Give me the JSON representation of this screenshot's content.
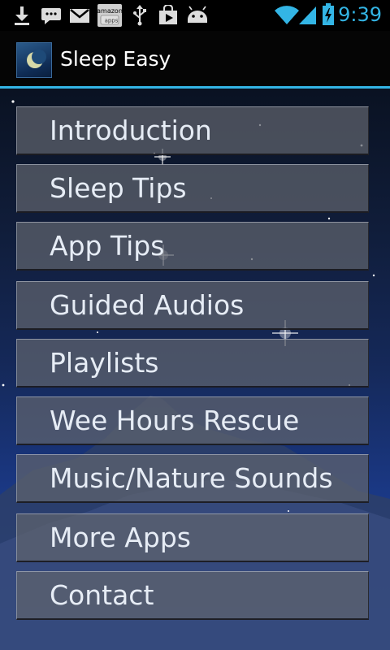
{
  "status_bar": {
    "time": "9:39",
    "accent_color": "#33b5e5",
    "icons": [
      "download-icon",
      "sms-icon",
      "gmail-icon",
      "amazon-appstore-icon",
      "usb-icon",
      "play-store-icon",
      "android-debug-icon",
      "wifi-icon",
      "signal-icon",
      "battery-charging-icon"
    ],
    "amazon_icon_text": {
      "line1": "amazon",
      "line2": "apps"
    }
  },
  "action_bar": {
    "app_icon": "crescent-moon-icon",
    "title": "Sleep Easy"
  },
  "menu": {
    "items": [
      {
        "label": "Introduction"
      },
      {
        "label": "Sleep Tips"
      },
      {
        "label": "App Tips"
      },
      {
        "label": "Guided Audios"
      },
      {
        "label": "Playlists"
      },
      {
        "label": "Wee Hours Rescue"
      },
      {
        "label": "Music/Nature Sounds"
      },
      {
        "label": "More Apps"
      },
      {
        "label": "Contact"
      }
    ]
  }
}
